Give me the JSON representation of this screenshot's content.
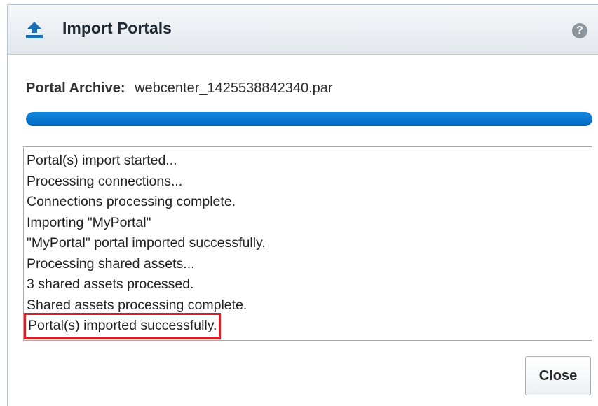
{
  "dialog": {
    "title": "Import Portals",
    "icon": "upload-icon",
    "help_icon": "help-icon",
    "help_glyph": "?"
  },
  "archive": {
    "label": "Portal Archive:",
    "value": "webcenter_1425538842340.par"
  },
  "progress": {
    "percent": 100,
    "color": "#0a78d6"
  },
  "log": {
    "lines": [
      "Portal(s) import started...",
      "Processing connections...",
      "Connections processing complete.",
      "Importing \"MyPortal\"",
      "\"MyPortal\" portal imported successfully.",
      "Processing shared assets...",
      "3 shared assets processed.",
      "Shared assets processing complete.",
      "Portal(s) imported successfully."
    ],
    "highlighted_index": 8,
    "highlight_color": "#e31b23"
  },
  "footer": {
    "close_label": "Close"
  }
}
